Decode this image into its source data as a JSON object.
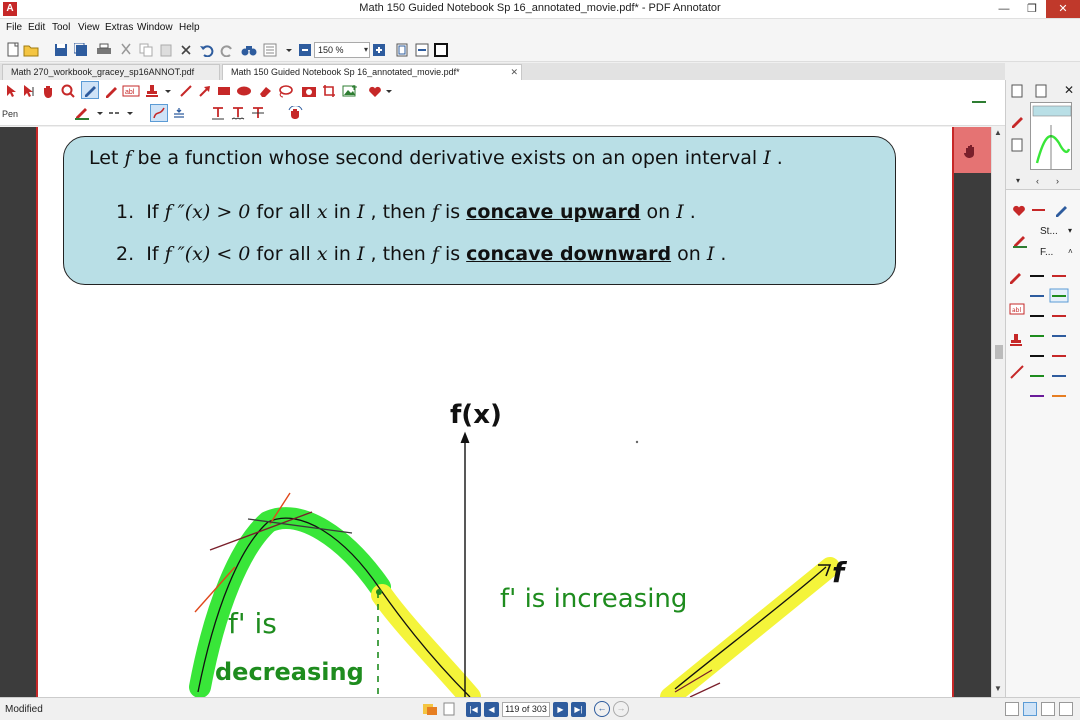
{
  "window": {
    "title": "Math 150 Guided Notebook Sp 16_annotated_movie.pdf* - PDF Annotator",
    "app_icon_letter": "A",
    "min": "—",
    "max": "❐",
    "close": "✕"
  },
  "menu": [
    "File",
    "Edit",
    "Tool",
    "View",
    "Extras",
    "Window",
    "Help"
  ],
  "toolbar": {
    "zoom": "150 %"
  },
  "tabs": [
    {
      "label": "Math 270_workbook_gracey_sp16ANNOT.pdf",
      "active": false
    },
    {
      "label": "Math 150 Guided Notebook Sp 16_annotated_movie.pdf*",
      "active": true
    }
  ],
  "annotation_toolbar": {
    "tool_label": "Pen"
  },
  "document": {
    "theorem": {
      "intro_a": "Let ",
      "intro_f": "f",
      "intro_b": " be a function whose second derivative exists on an open interval ",
      "intro_I": "I",
      "intro_c": " .",
      "item1_num": "1.",
      "item1_if": "If ",
      "item1_cond": "f ″(x) > 0",
      "item1_forall": " for all ",
      "item1_x": "x",
      "item1_in": " in ",
      "item1_I": "I",
      "item1_then": " , then ",
      "item1_f": "f",
      "item1_is": " is ",
      "item1_concl": "concave upward",
      "item1_on": " on ",
      "item1_I2": "I",
      "item1_end": " .",
      "item2_num": "2.",
      "item2_if": "If ",
      "item2_cond": "f ″(x) < 0",
      "item2_forall": " for all ",
      "item2_x": "x",
      "item2_in": " in ",
      "item2_I": "I",
      "item2_then": " , then ",
      "item2_f": "f",
      "item2_is": " is ",
      "item2_concl": "concave downward",
      "item2_on": " on ",
      "item2_I2": "I",
      "item2_end": " ."
    },
    "handwriting": {
      "axis_label": "f(x)",
      "curve_label": "f",
      "increasing_note": "f' is increasing",
      "decreasing_note_1": "f' is",
      "decreasing_note_2": "decreasing"
    },
    "colors": {
      "highlight_green": "#39e639",
      "highlight_yellow": "#f4f43a",
      "ink_green": "#1e8c1e",
      "ink_black": "#111111",
      "tangent_red": "#e0481c",
      "tangent_dark": "#7a1f2b",
      "theorem_bg": "#b9dfe6"
    }
  },
  "right_panel": {
    "style_label": "St...",
    "font_label": "F..."
  },
  "status": {
    "text": "Modified",
    "page_indicator": "119 of 303"
  }
}
